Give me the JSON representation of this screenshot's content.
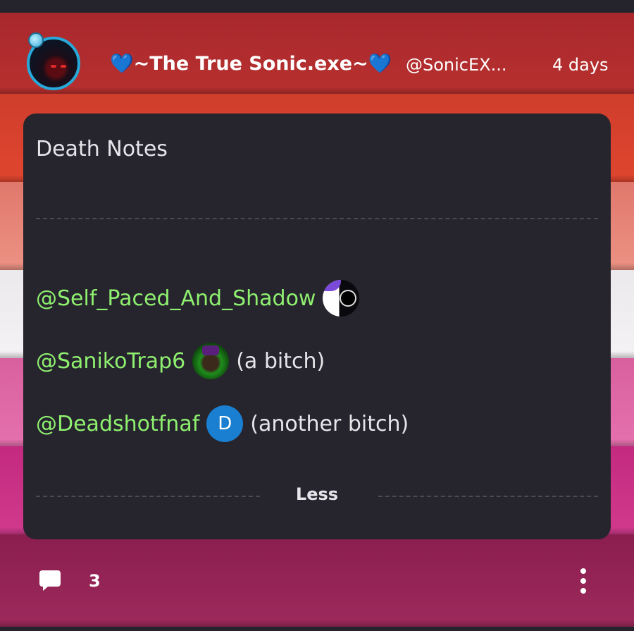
{
  "post": {
    "author_name": "~The True Sonic.exe~",
    "name_emoji_left": "💙",
    "name_emoji_right": "💙",
    "handle": "@SonicEX...",
    "time": "4 days"
  },
  "card": {
    "title": "Death Notes",
    "mentions": [
      {
        "tag": "@Self_Paced_And_Shadow",
        "note": ""
      },
      {
        "tag": "@SanikoTrap6",
        "note": "(a bitch)"
      },
      {
        "tag": "@Deadshotfnaf",
        "avatar_letter": "D",
        "note": "(another bitch)"
      }
    ],
    "less_label": "Less"
  },
  "footer": {
    "comment_count": "3"
  },
  "colors": {
    "mention": "#8ff06f",
    "card_bg": "#26252e",
    "avatar_ring": "#27a9da",
    "deadshot_avatar": "#1a7fd0"
  },
  "icons": [
    "comment-icon",
    "more-vertical-icon"
  ]
}
